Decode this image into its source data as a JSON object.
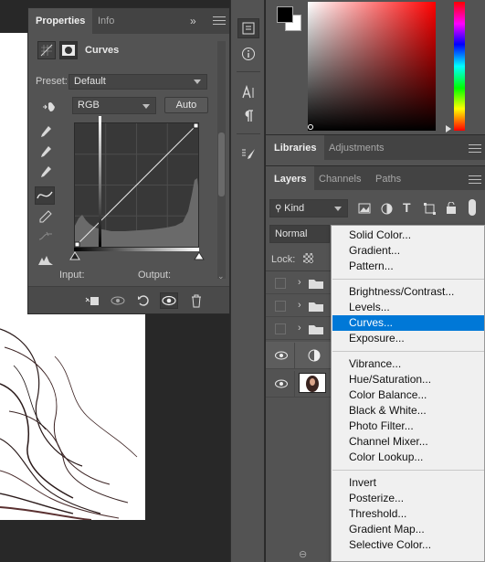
{
  "properties_panel": {
    "tabs": [
      "Properties",
      "Info"
    ],
    "adjustment_title": "Curves",
    "preset_label": "Preset:",
    "preset_value": "Default",
    "channel_value": "RGB",
    "auto_label": "Auto",
    "input_label": "Input:",
    "output_label": "Output:",
    "expand_glyph": "»"
  },
  "libraries_panel": {
    "tabs": [
      "Libraries",
      "Adjustments"
    ]
  },
  "layers_panel": {
    "tabs": [
      "Layers",
      "Channels",
      "Paths"
    ],
    "filter_kind": "Kind",
    "blend_mode": "Normal",
    "lock_label": "Lock:",
    "rows": [
      {
        "type": "group",
        "visible": false
      },
      {
        "type": "group",
        "visible": false
      },
      {
        "type": "group",
        "visible": false
      },
      {
        "type": "adjustment",
        "visible": true
      },
      {
        "type": "image",
        "visible": true
      }
    ]
  },
  "adjustment_menu": {
    "selected": "Curves...",
    "groups": [
      [
        "Solid Color...",
        "Gradient...",
        "Pattern..."
      ],
      [
        "Brightness/Contrast...",
        "Levels...",
        "Curves...",
        "Exposure..."
      ],
      [
        "Vibrance...",
        "Hue/Saturation...",
        "Color Balance...",
        "Black & White...",
        "Photo Filter...",
        "Channel Mixer...",
        "Color Lookup..."
      ],
      [
        "Invert",
        "Posterize...",
        "Threshold...",
        "Gradient Map...",
        "Selective Color..."
      ]
    ]
  },
  "colors": {
    "panel": "#535353",
    "panel_dark": "#434343",
    "menu_bg": "#f0f0f0",
    "menu_highlight": "#0078d7"
  }
}
